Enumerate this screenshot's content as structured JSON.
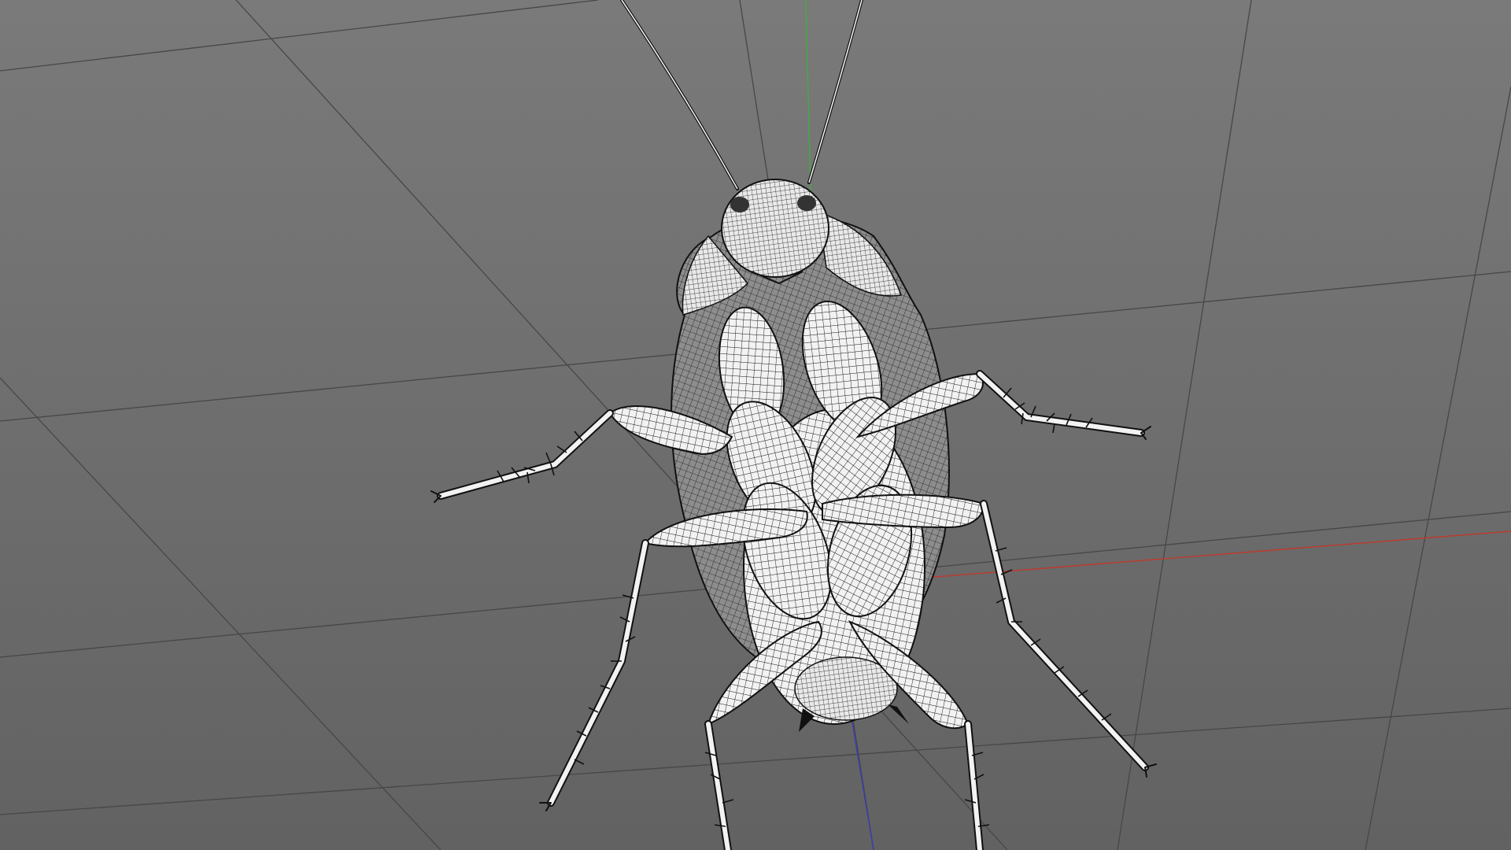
{
  "viewport": {
    "mode": "3d-perspective",
    "display": "shaded-wireframe",
    "background_color": "#707070",
    "grid_color": "#4a4a4a",
    "grid_visible": true,
    "axes": {
      "x_color": "#c0392b",
      "y_color": "#3fae3f",
      "z_color": "#3b3bb0"
    }
  },
  "object": {
    "icon": "cockroach-model",
    "surface_color": "#f2f2f2",
    "wire_color": "#111111"
  }
}
